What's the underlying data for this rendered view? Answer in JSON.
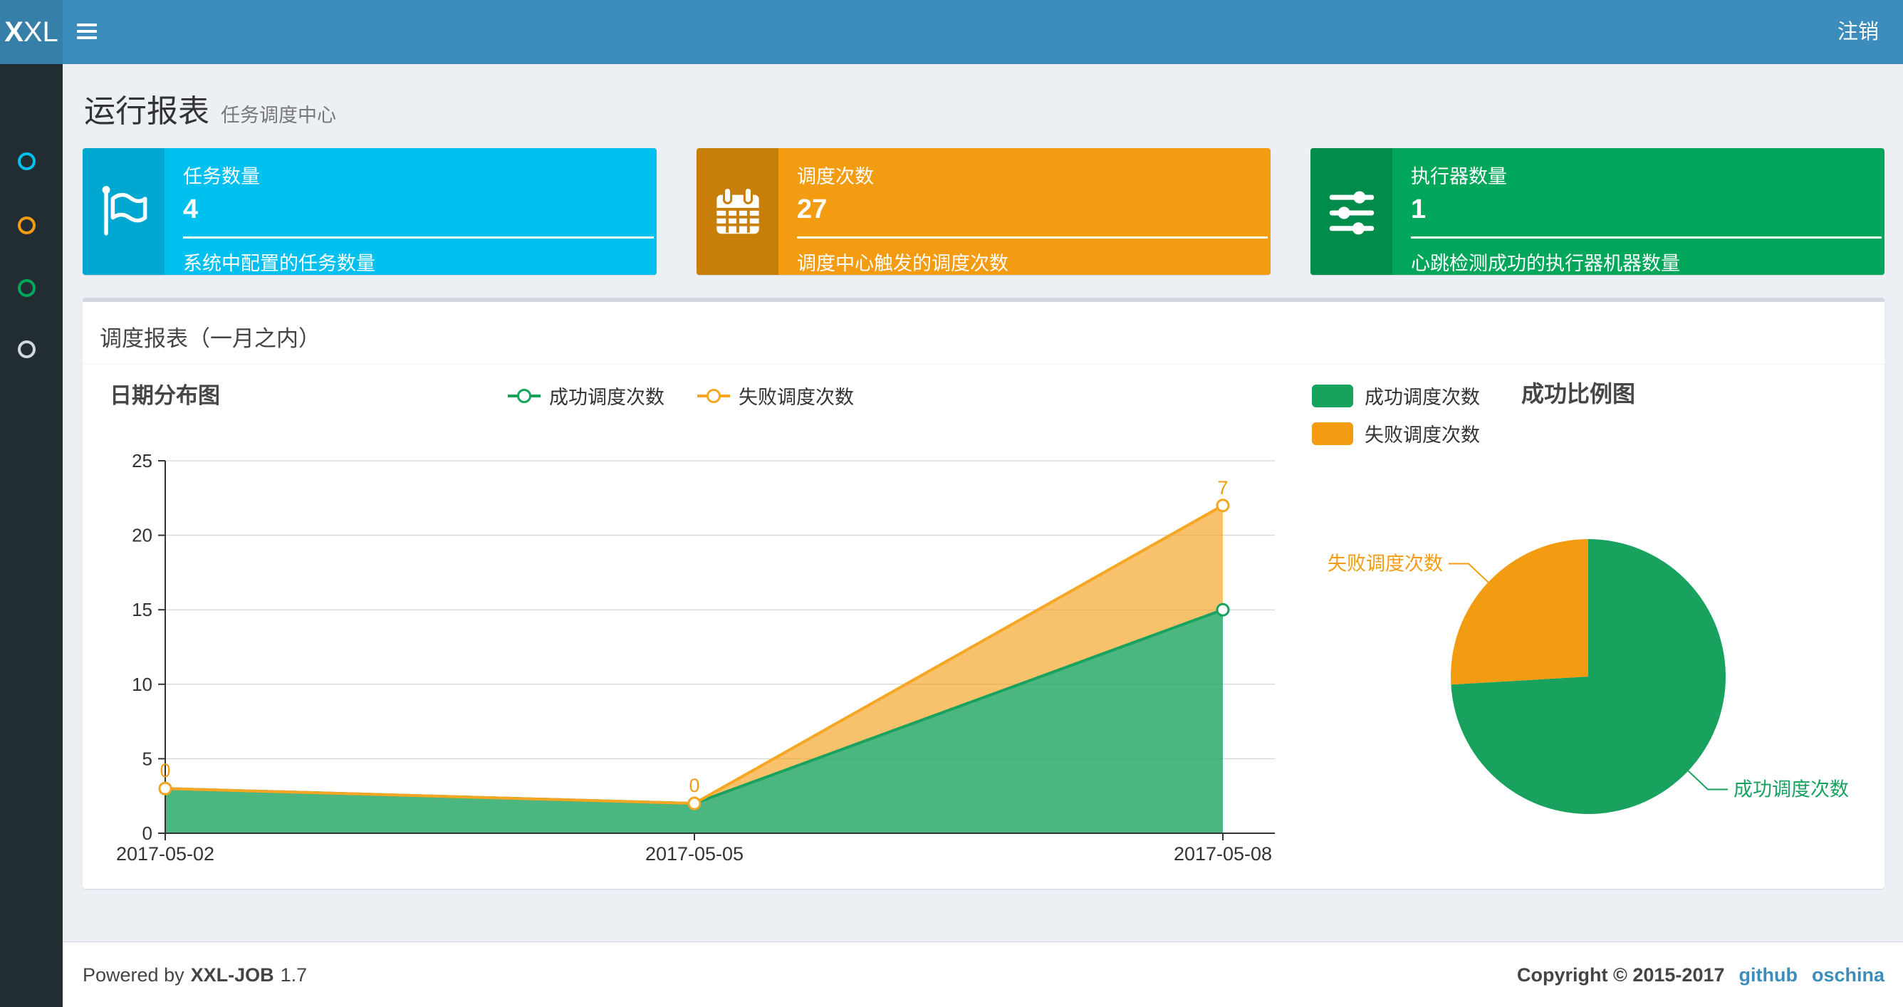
{
  "navbar": {
    "logo_bold": "X",
    "logo_rest": "XL",
    "logout_label": "注销"
  },
  "sidebar": {
    "items": [
      {
        "color": "#00c0ef"
      },
      {
        "color": "#f39c12"
      },
      {
        "color": "#00a65a"
      },
      {
        "color": "#d2d6de"
      }
    ]
  },
  "page_header": {
    "title": "运行报表",
    "subtitle": "任务调度中心"
  },
  "info_boxes": [
    {
      "title": "任务数量",
      "value": "4",
      "desc": "系统中配置的任务数量",
      "bg": "#00c0ef",
      "icon_bg": "#00a7d0",
      "icon": "flag-icon"
    },
    {
      "title": "调度次数",
      "value": "27",
      "desc": "调度中心触发的调度次数",
      "bg": "#f39c12",
      "icon_bg": "#c87f0a",
      "icon": "calendar-icon"
    },
    {
      "title": "执行器数量",
      "value": "1",
      "desc": "心跳检测成功的执行器机器数量",
      "bg": "#00a65a",
      "icon_bg": "#008d4c",
      "icon": "sliders-icon"
    }
  ],
  "panel": {
    "title": "调度报表（一月之内）"
  },
  "chart_data": [
    {
      "type": "area",
      "title": "日期分布图",
      "categories": [
        "2017-05-02",
        "2017-05-05",
        "2017-05-08"
      ],
      "stacked": true,
      "series": [
        {
          "name": "成功调度次数",
          "values": [
            3,
            2,
            15
          ],
          "color": "#19a15e",
          "fill": "rgba(25,161,94,0.78)"
        },
        {
          "name": "失败调度次数",
          "values": [
            0,
            0,
            7
          ],
          "color": "#f5a623",
          "fill": "rgba(243,156,18,0.62)",
          "labels": [
            "0",
            "0",
            "7"
          ],
          "label_color": "#f39c12"
        }
      ],
      "ylim": [
        0,
        25
      ],
      "yticks": [
        0,
        5,
        10,
        15,
        20,
        25
      ],
      "grid": true,
      "legend_position": "top-center"
    },
    {
      "type": "pie",
      "title": "成功比例图",
      "slices": [
        {
          "name": "成功调度次数",
          "value": 20,
          "pct": 74.1,
          "color": "#19a15e"
        },
        {
          "name": "失败调度次数",
          "value": 7,
          "pct": 25.9,
          "color": "#f39c12"
        }
      ],
      "legend_position": "top-left"
    }
  ],
  "footer": {
    "powered_prefix": "Powered by",
    "brand": "XXL-JOB",
    "version": "1.7",
    "copyright": "Copyright © 2015-2017",
    "links": [
      {
        "label": "github"
      },
      {
        "label": "oschina"
      }
    ]
  }
}
